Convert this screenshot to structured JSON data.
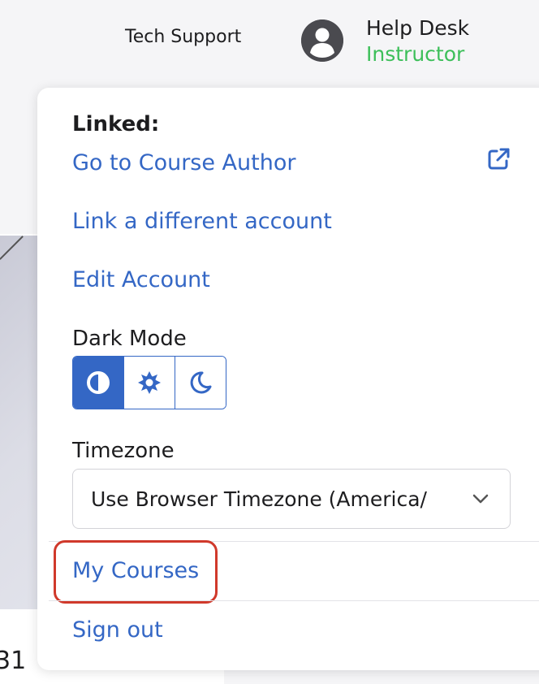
{
  "header": {
    "tech_support": "Tech Support",
    "user_name": "Help Desk",
    "user_role": "Instructor",
    "role_color": "#3dbf5a"
  },
  "menu": {
    "linked_label": "Linked:",
    "go_to_course_author": "Go to Course Author",
    "external_link_icon": "external-link-icon",
    "link_different_account": "Link a different account",
    "edit_account": "Edit Account",
    "dark_mode_label": "Dark Mode",
    "dark_mode_options": [
      {
        "icon": "auto-contrast-icon",
        "active": true
      },
      {
        "icon": "sun-icon",
        "active": false
      },
      {
        "icon": "moon-icon",
        "active": false
      }
    ],
    "timezone_label": "Timezone",
    "timezone_value": "Use Browser Timezone (America/",
    "my_courses": "My Courses",
    "sign_out": "Sign out"
  },
  "background": {
    "card_text": "31"
  },
  "colors": {
    "link": "#3467c5",
    "highlight": "#d0392b"
  }
}
